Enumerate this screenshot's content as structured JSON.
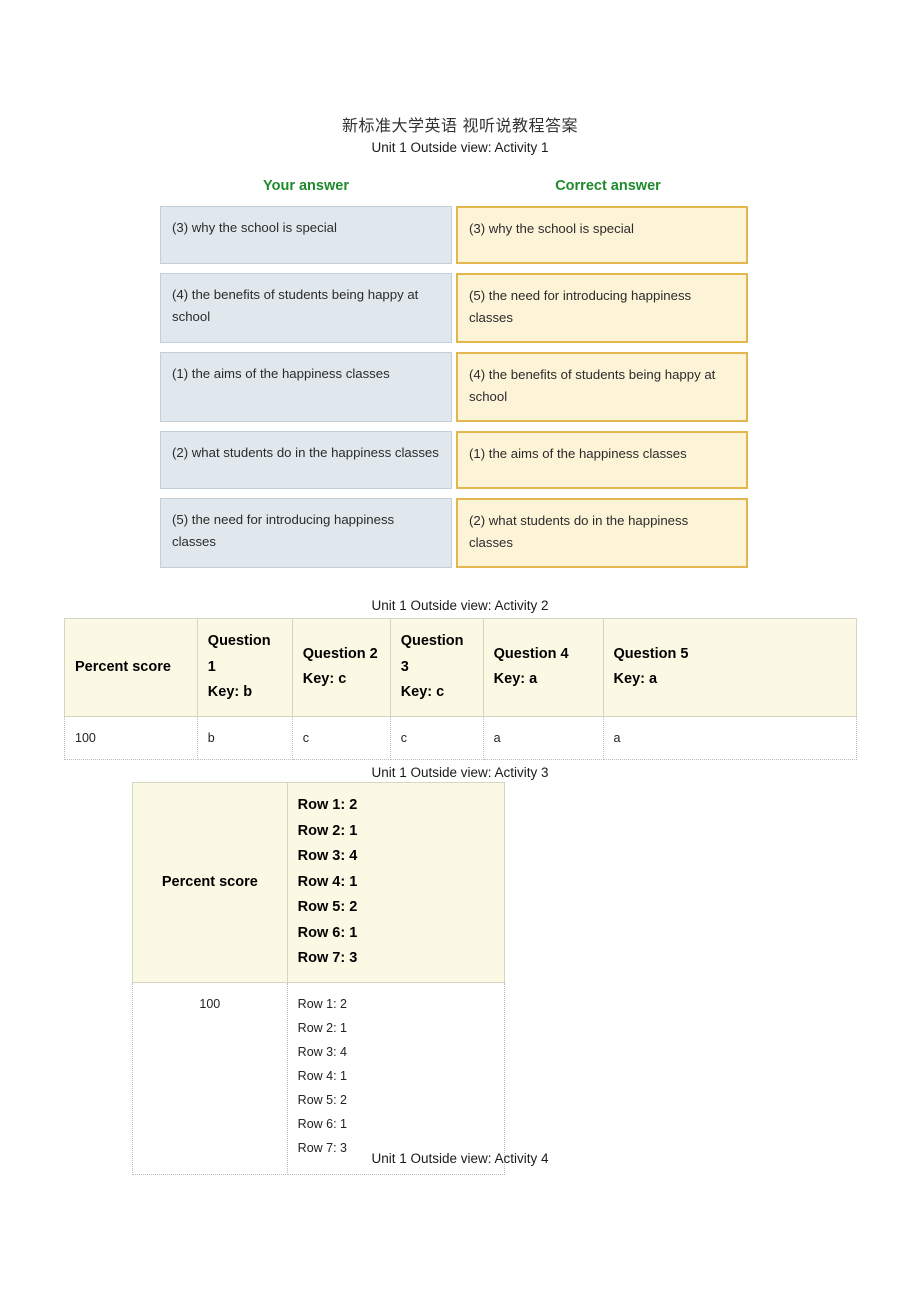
{
  "document": {
    "title": "新标准大学英语 视听说教程答案"
  },
  "activities": {
    "act1_label": "Unit 1 Outside view: Activity 1",
    "act2_label": "Unit 1 Outside view: Activity 2",
    "act3_label": "Unit 1 Outside view: Activity 3",
    "act4_label": "Unit 1 Outside view: Activity 4"
  },
  "activity1": {
    "head_your": "Your answer",
    "head_correct": "Correct answer",
    "accent_your_bg": "#e1e8ed",
    "accent_correct_bg": "#fdf3d7",
    "accent_correct_border": "#e2b84e",
    "head_color": "#1f8a2c",
    "rows": [
      {
        "your": "(3) why the school is special",
        "correct": "(3) why the school is special"
      },
      {
        "your": "(4) the benefits of students being happy at school",
        "correct": "(5) the need for introducing happiness classes"
      },
      {
        "your": "(1) the aims of the happiness classes",
        "correct": "(4) the benefits of students being happy at school"
      },
      {
        "your": "(2) what students do in the happiness classes",
        "correct": "(1) the aims of the happiness classes"
      },
      {
        "your": "(5) the need for introducing happiness classes",
        "correct": "(2) what students do in the happiness classes"
      }
    ]
  },
  "activity2": {
    "headers": [
      "Percent score",
      "Question 1\nKey: b",
      "Question 2\nKey: c",
      "Question 3\nKey: c",
      "Question 4\nKey: a",
      "Question 5\nKey: a"
    ],
    "header_parts": [
      {
        "line1": "Percent score",
        "line2": ""
      },
      {
        "line1": "Question 1",
        "line2": "Key: b"
      },
      {
        "line1": "Question 2",
        "line2": "Key: c"
      },
      {
        "line1": "Question 3",
        "line2": "Key: c"
      },
      {
        "line1": "Question 4",
        "line2": "Key: a"
      },
      {
        "line1": "Question 5",
        "line2": "Key: a"
      }
    ],
    "rows": [
      [
        "100",
        "b",
        "c",
        "c",
        "a",
        "a"
      ]
    ]
  },
  "activity3": {
    "header_score": "Percent score",
    "header_rows": [
      "Row 1: 2",
      "Row 2: 1",
      "Row 3: 4",
      "Row 4: 1",
      "Row 5: 2",
      "Row 6: 1",
      "Row 7: 3"
    ],
    "score_value": "100",
    "answer_rows": [
      "Row 1: 2",
      "Row 2: 1",
      "Row 3: 4",
      "Row 4: 1",
      "Row 5: 2",
      "Row 6: 1",
      "Row 7: 3"
    ]
  }
}
